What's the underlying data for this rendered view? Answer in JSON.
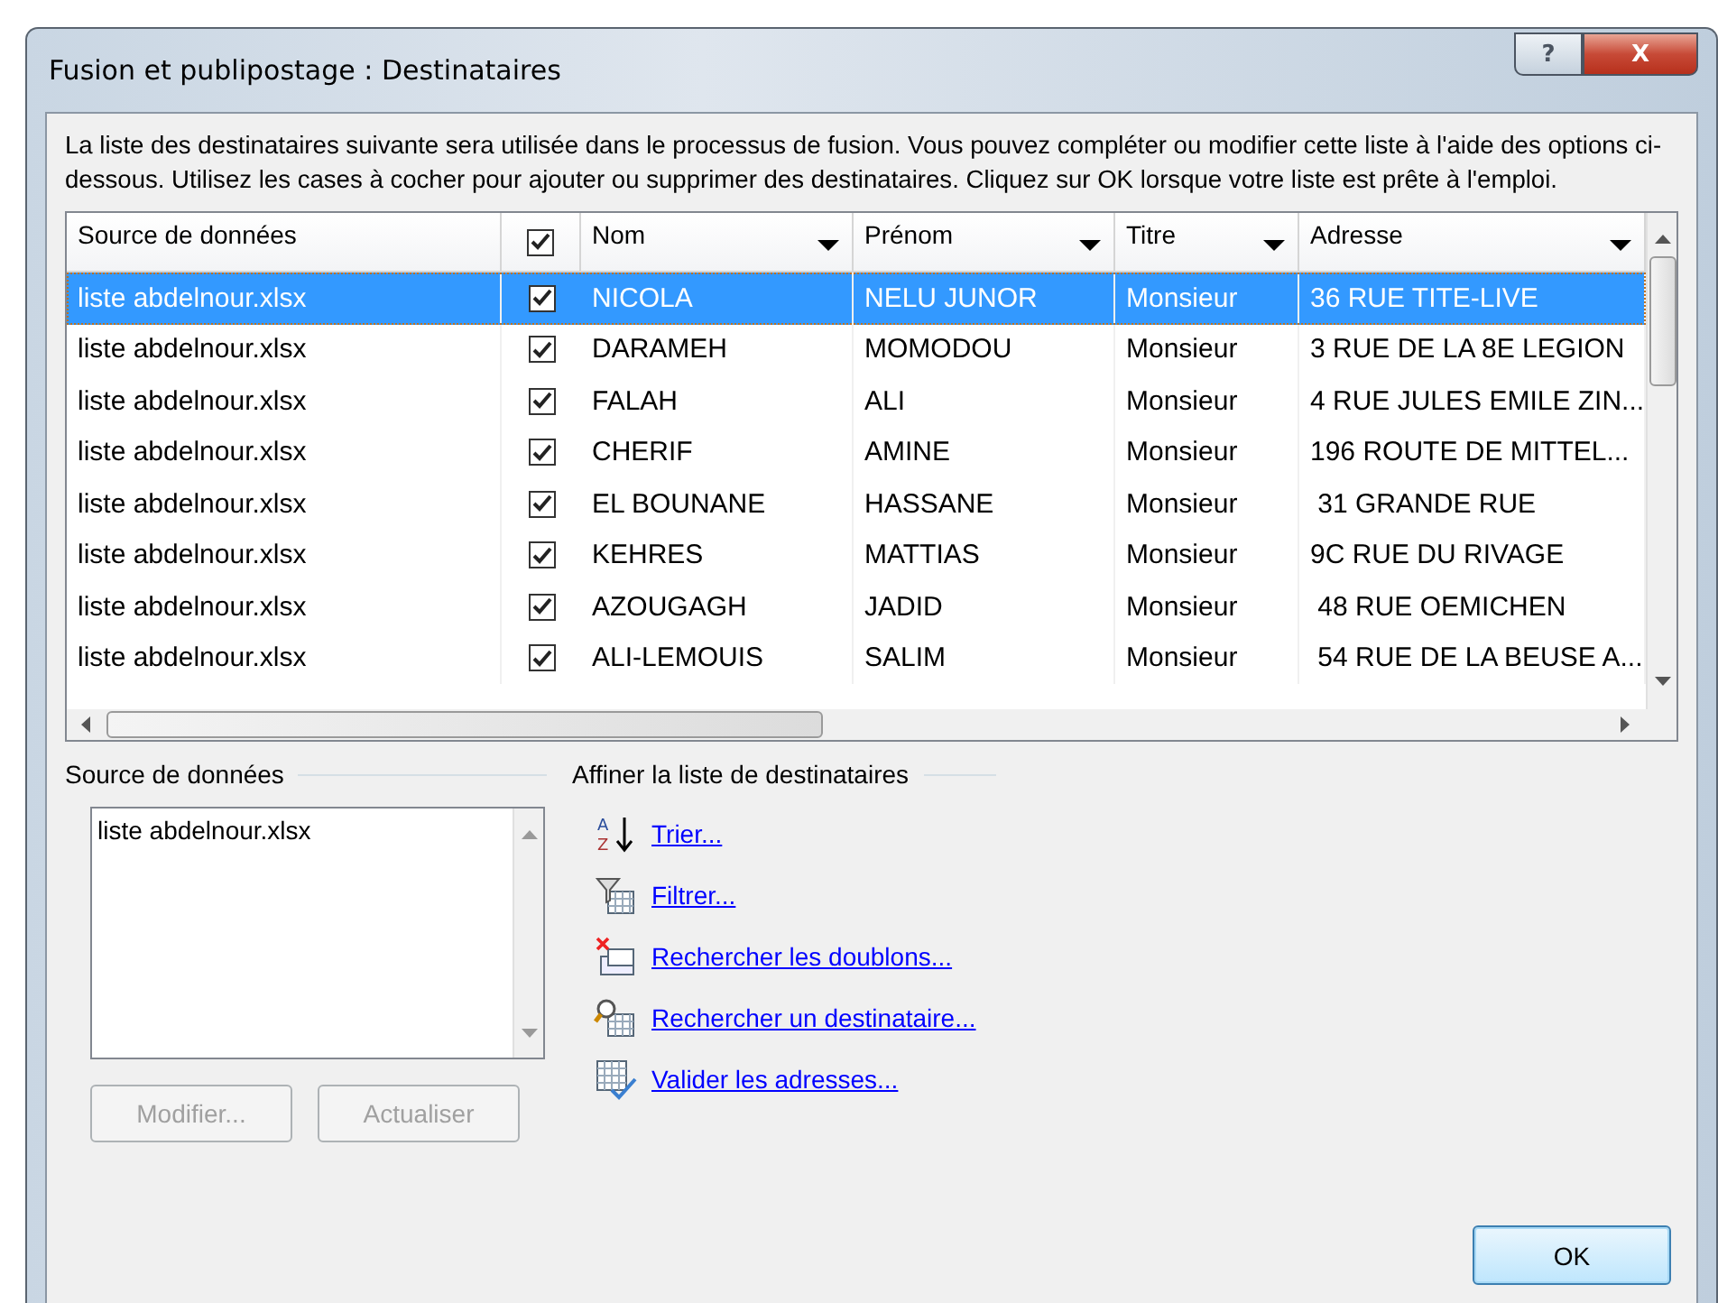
{
  "window": {
    "title": "Fusion et publipostage : Destinataires",
    "controls": [
      {
        "kind": "help",
        "label": "?"
      },
      {
        "kind": "close",
        "label": "X"
      }
    ]
  },
  "description": "La liste des destinataires suivante sera utilisée dans le processus de fusion. Vous pouvez compléter ou modifier cette liste à l'aide des options ci-dessous. Utilisez les cases à cocher pour ajouter ou supprimer des destinataires. Cliquez sur OK lorsque votre liste est prête à l'emploi.",
  "table": {
    "columns": [
      {
        "kind": "text",
        "label": "Source de données",
        "dropdown": false
      },
      {
        "kind": "check",
        "checked": true
      },
      {
        "kind": "text",
        "label": "Nom",
        "dropdown": true
      },
      {
        "kind": "text",
        "label": "Prénom",
        "dropdown": true
      },
      {
        "kind": "text",
        "label": "Titre",
        "dropdown": true
      },
      {
        "kind": "text",
        "label": "Adresse",
        "dropdown": true
      }
    ],
    "rows": [
      {
        "selected": true,
        "checked": true,
        "cells": [
          "liste abdelnour.xlsx",
          "",
          "NICOLA",
          "NELU JUNOR",
          "Monsieur",
          "36 RUE TITE-LIVE"
        ]
      },
      {
        "selected": false,
        "checked": true,
        "cells": [
          "liste abdelnour.xlsx",
          "",
          "DARAMEH",
          "MOMODOU",
          "Monsieur",
          "3 RUE DE LA 8E LEGION"
        ]
      },
      {
        "selected": false,
        "checked": true,
        "cells": [
          "liste abdelnour.xlsx",
          "",
          "FALAH",
          "ALI",
          "Monsieur",
          "4 RUE JULES EMILE ZIN..."
        ]
      },
      {
        "selected": false,
        "checked": true,
        "cells": [
          "liste abdelnour.xlsx",
          "",
          "CHERIF",
          "AMINE",
          "Monsieur",
          "196 ROUTE DE MITTEL..."
        ]
      },
      {
        "selected": false,
        "checked": true,
        "cells": [
          "liste abdelnour.xlsx",
          "",
          "EL BOUNANE",
          "HASSANE",
          "Monsieur",
          " 31 GRANDE RUE"
        ]
      },
      {
        "selected": false,
        "checked": true,
        "cells": [
          "liste abdelnour.xlsx",
          "",
          "KEHRES",
          "MATTIAS",
          "Monsieur",
          "9C RUE DU RIVAGE"
        ]
      },
      {
        "selected": false,
        "checked": true,
        "cells": [
          "liste abdelnour.xlsx",
          "",
          "AZOUGAGH",
          "JADID",
          "Monsieur",
          " 48 RUE OEMICHEN"
        ]
      },
      {
        "selected": false,
        "checked": true,
        "cells": [
          "liste abdelnour.xlsx",
          "",
          "ALI-LEMOUIS",
          "SALIM",
          "Monsieur",
          " 54 RUE DE LA BEUSE A..."
        ]
      }
    ]
  },
  "source": {
    "heading": "Source de données",
    "items": [
      "liste abdelnour.xlsx"
    ],
    "buttons": [
      {
        "label": "Modifier...",
        "disabled": true
      },
      {
        "label": "Actualiser",
        "disabled": true
      }
    ]
  },
  "refine": {
    "heading": "Affiner la liste de destinataires",
    "links": [
      {
        "kind": "sort",
        "label": "Trier...",
        "icon_letters": [
          "A",
          "Z"
        ]
      },
      {
        "kind": "filter",
        "label": "Filtrer..."
      },
      {
        "kind": "duplicates",
        "label": "Rechercher les doublons..."
      },
      {
        "kind": "find",
        "label": "Rechercher un destinataire..."
      },
      {
        "kind": "validate",
        "label": "Valider les adresses..."
      }
    ]
  },
  "ok_button": {
    "label": "OK"
  }
}
